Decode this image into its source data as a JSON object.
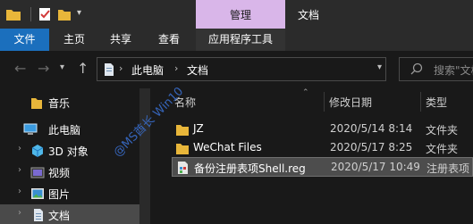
{
  "titlebar": {
    "context_tab": "管理",
    "window_title": "文档"
  },
  "ribbon": {
    "tabs": [
      "文件",
      "主页",
      "共享",
      "查看",
      "应用程序工具"
    ]
  },
  "address": {
    "crumbs": [
      "此电脑",
      "文档"
    ]
  },
  "search": {
    "placeholder": "搜索\"文档\""
  },
  "navpane": {
    "items": [
      {
        "label": "音乐",
        "icon": "music-folder-icon"
      },
      {
        "label": "此电脑",
        "icon": "computer-icon"
      },
      {
        "label": "3D 对象",
        "icon": "3d-objects-icon"
      },
      {
        "label": "视频",
        "icon": "videos-icon"
      },
      {
        "label": "图片",
        "icon": "pictures-icon"
      },
      {
        "label": "文档",
        "icon": "documents-icon"
      }
    ]
  },
  "columns": {
    "name": "名称",
    "date": "修改日期",
    "type": "类型"
  },
  "files": [
    {
      "name": "JZ",
      "date": "2020/5/14 8:14",
      "type": "文件夹",
      "icon": "folder-icon"
    },
    {
      "name": "WeChat Files",
      "date": "2020/5/17 8:25",
      "type": "文件夹",
      "icon": "folder-icon"
    },
    {
      "name": "备份注册表项Shell.reg",
      "date": "2020/5/17 10:49",
      "type": "注册表项",
      "icon": "registry-file-icon"
    }
  ],
  "watermark": "@MS酋长 Win10",
  "colors": {
    "file_tab": "#1b6fbd",
    "context_tab": "#d9b6e9",
    "folder": "#e8b63a",
    "selection": "#4d4d4d"
  }
}
